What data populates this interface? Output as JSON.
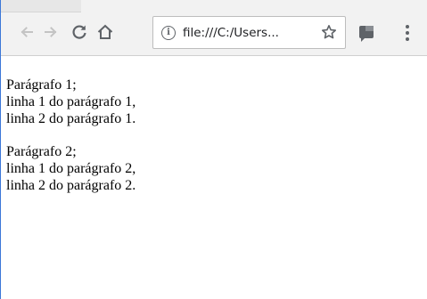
{
  "browser": {
    "address_bar": {
      "url": "file:///C:/Users..."
    },
    "icons": {
      "back": "arrow-left-icon",
      "forward": "arrow-right-icon",
      "reload": "reload-icon",
      "home": "home-icon",
      "info": "info-icon",
      "bookmark": "star-icon",
      "extension": "extension-icon",
      "menu": "more-vert-icon"
    },
    "colors": {
      "toolbar": "#f2f2f2",
      "window_border": "#3c78d8",
      "icon_active": "#5f6368",
      "icon_disabled": "#c4c4c4"
    }
  },
  "page": {
    "paragraphs": [
      {
        "lines": [
          "Parágrafo 1;",
          "linha 1 do parágrafo 1,",
          "linha 2 do parágrafo 1."
        ]
      },
      {
        "lines": [
          "Parágrafo 2;",
          "linha 1 do parágrafo 2,",
          "linha 2 do parágrafo 2."
        ]
      }
    ]
  }
}
